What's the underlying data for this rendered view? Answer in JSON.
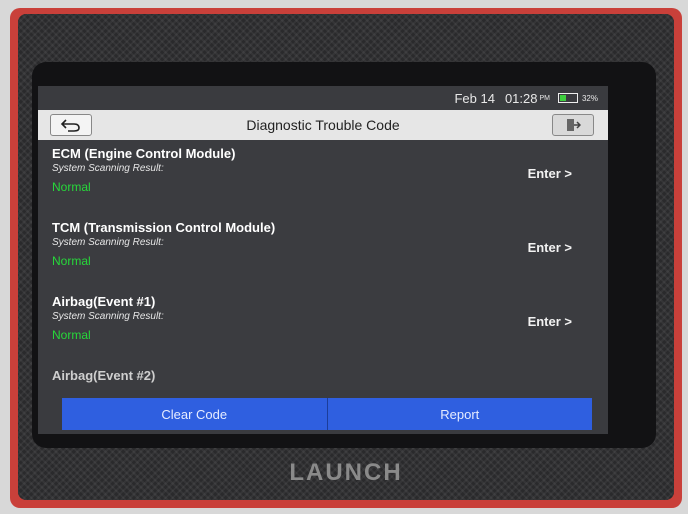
{
  "status": {
    "date": "Feb 14",
    "time": "01:28",
    "ampm": "PM",
    "battery": "32%"
  },
  "header": {
    "title": "Diagnostic Trouble Code"
  },
  "modules": [
    {
      "name": "ECM (Engine Control Module)",
      "result_label": "System Scanning Result:",
      "result": "Normal",
      "action": "Enter >"
    },
    {
      "name": "TCM (Transmission Control Module)",
      "result_label": "System Scanning Result:",
      "result": "Normal",
      "action": "Enter >"
    },
    {
      "name": "Airbag(Event #1)",
      "result_label": "System Scanning Result:",
      "result": "Normal",
      "action": "Enter >"
    },
    {
      "name": "Airbag(Event #2)"
    }
  ],
  "footer": {
    "clear_code": "Clear Code",
    "report": "Report"
  },
  "device": {
    "brand": "LAUNCH"
  },
  "colors": {
    "normal": "#27d83a",
    "button": "#2f5fe0"
  }
}
